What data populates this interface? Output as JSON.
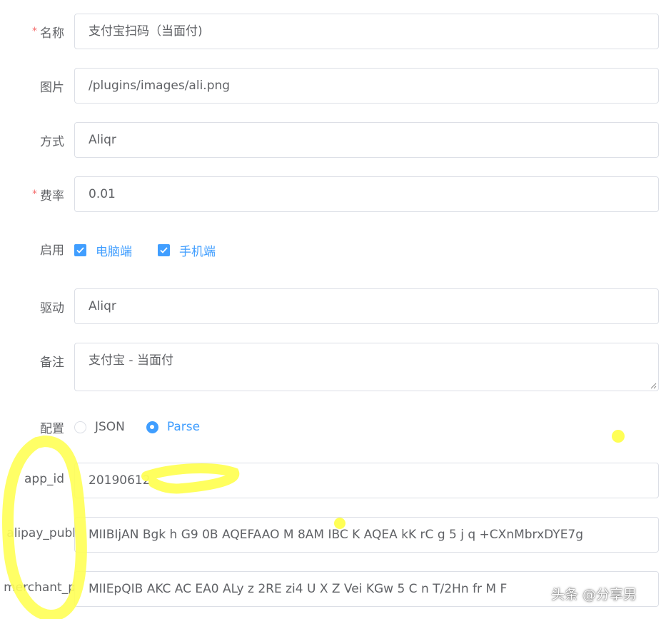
{
  "form": {
    "name": {
      "label": "名称",
      "required": true,
      "value": "支付宝扫码（当面付)"
    },
    "image": {
      "label": "图片",
      "value": "/plugins/images/ali.png"
    },
    "method": {
      "label": "方式",
      "value": "Aliqr"
    },
    "rate": {
      "label": "费率",
      "required": true,
      "value": "0.01"
    },
    "enable": {
      "label": "启用",
      "options": [
        {
          "label": "电脑端",
          "checked": true
        },
        {
          "label": "手机端",
          "checked": true
        }
      ]
    },
    "driver": {
      "label": "驱动",
      "value": "Aliqr"
    },
    "remark": {
      "label": "备注",
      "value": "支付宝 - 当面付"
    },
    "config": {
      "label": "配置",
      "options": [
        {
          "label": "JSON",
          "selected": false
        },
        {
          "label": "Parse",
          "selected": true
        }
      ]
    },
    "app_id": {
      "label": "app_id",
      "value": "20190612"
    },
    "alipay_public": {
      "label": "alipay_publ",
      "value": "MIIBIjAN Bgk  h  G9 0B  AQEFAAO  M  8AM  IBC  K  AQEA  kK  rC   g  5  j    q   +CXnMbrxDYE7g"
    },
    "merchant_private": {
      "label": "merchant_p",
      "value": "MIIEpQIB  AKC  AC EA0  ALy  z 2RE  zi4  U  X  Z  Vei KGw   5  C  n  T/2Hn   fr  M  F"
    }
  },
  "watermark": "头条 @分享男",
  "colors": {
    "primary": "#409eff",
    "required": "#f56c6c",
    "text": "#606266",
    "border": "#dcdfe6",
    "highlight": "#ffff55"
  }
}
